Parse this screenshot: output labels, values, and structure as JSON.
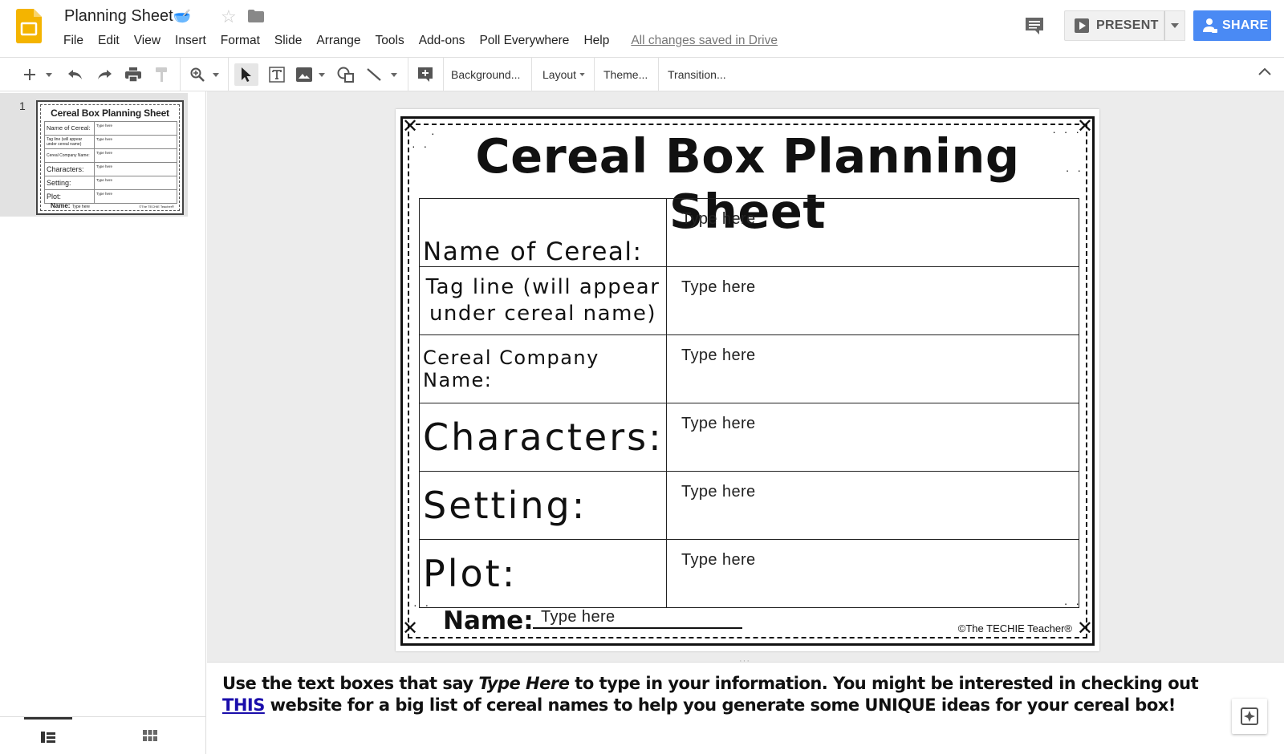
{
  "header": {
    "title": "Planning Sheet",
    "title_emoji": "🥣",
    "saved_status": "All changes saved in Drive",
    "present_label": "PRESENT",
    "share_label": "SHARE"
  },
  "menu": [
    "File",
    "Edit",
    "View",
    "Insert",
    "Format",
    "Slide",
    "Arrange",
    "Tools",
    "Add-ons",
    "Poll Everywhere",
    "Help"
  ],
  "toolbar": {
    "background_label": "Background...",
    "layout_label": "Layout",
    "theme_label": "Theme...",
    "transition_label": "Transition..."
  },
  "filmstrip": {
    "slide_number": "1"
  },
  "slide": {
    "title": "Cereal Box Planning Sheet",
    "rows": [
      {
        "label": "Name of Cereal:",
        "value": "Type here"
      },
      {
        "label": "Tag line (will appear under cereal name)",
        "value": "Type here"
      },
      {
        "label": "Cereal Company Name:",
        "value": "Type here"
      },
      {
        "label": "Characters:",
        "value": "Type here"
      },
      {
        "label": "Setting:",
        "value": "Type here"
      },
      {
        "label": "Plot:",
        "value": "Type here"
      }
    ],
    "name_label": "Name:",
    "name_value": "Type here",
    "copyright": "©The TECHIE Teacher®"
  },
  "notes": {
    "text_1": "Use the text boxes that say ",
    "text_italic": "Type Here",
    "text_2": " to type in your information. You might be interested in checking out ",
    "link_text": "THIS",
    "text_3": " website for a big list of cereal names to help you generate some UNIQUE ideas for your cereal box!"
  },
  "colors": {
    "accent": "#4a8af4",
    "slides_logo": "#f4b400",
    "link": "#1a0dab"
  }
}
